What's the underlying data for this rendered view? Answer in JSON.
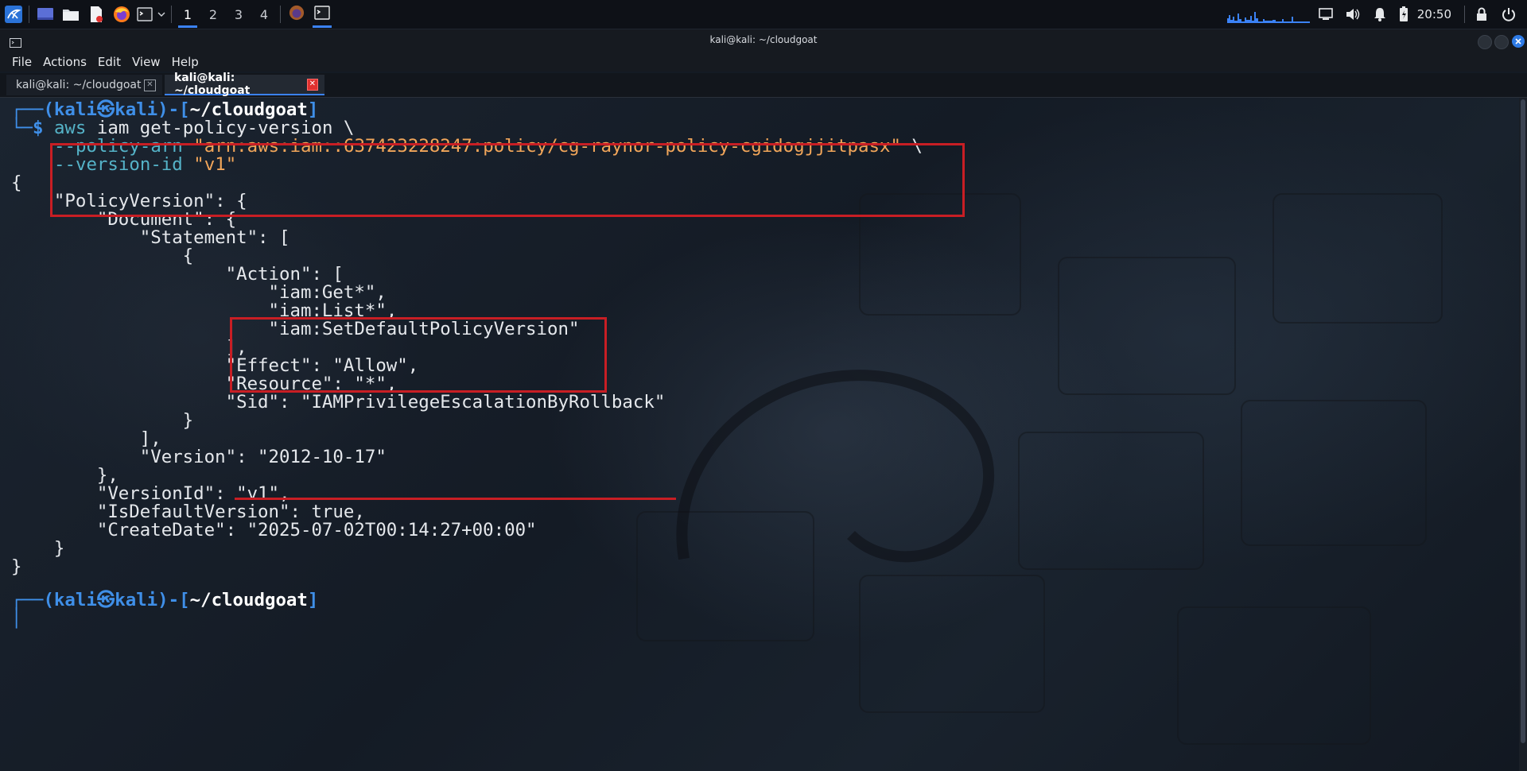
{
  "panel": {
    "workspaces": [
      "1",
      "2",
      "3",
      "4"
    ],
    "active_workspace": "1",
    "clock": "20:50",
    "icons": {
      "menu": "kali-dragon-icon",
      "desktop": "show-desktop-icon",
      "files": "file-manager-icon",
      "editor": "text-editor-icon",
      "browser": "firefox-icon",
      "terminal": "terminal-icon",
      "display": "display-icon",
      "volume": "volume-icon",
      "notifications": "bell-icon",
      "battery": "battery-charging-icon",
      "lock": "lock-icon",
      "power": "power-icon"
    }
  },
  "window": {
    "title": "kali@kali: ~/cloudgoat",
    "menu": [
      "File",
      "Actions",
      "Edit",
      "View",
      "Help"
    ],
    "tabs": [
      {
        "label": "kali@kali: ~/cloudgoat",
        "active": false
      },
      {
        "label": "kali@kali: ~/cloudgoat",
        "active": true
      }
    ]
  },
  "terminal": {
    "prompt": {
      "frame_top": "┌──(",
      "user": "kali",
      "sym": "㉿",
      "host": "kali",
      "mid": ")-[",
      "path": "~/cloudgoat",
      "end": "]",
      "frame_bottom": "└─",
      "dollar": "$"
    },
    "cmd1_a": "aws",
    "cmd1_b": " iam get-policy-version \\",
    "cmd2_opt": "--policy-arn",
    "cmd2_str": "\"arn:aws:iam::637423228247:policy/cg-raynor-policy-cgidogjjitpasx\"",
    "cmd2_tail": " \\",
    "cmd3_opt": "--version-id",
    "cmd3_str": "\"v1\"",
    "output": [
      "{",
      "    \"PolicyVersion\": {",
      "        \"Document\": {",
      "            \"Statement\": [",
      "                {",
      "                    \"Action\": [",
      "                        \"iam:Get*\",",
      "                        \"iam:List*\",",
      "                        \"iam:SetDefaultPolicyVersion\"",
      "                    ],",
      "                    \"Effect\": \"Allow\",",
      "                    \"Resource\": \"*\",",
      "                    \"Sid\": \"IAMPrivilegeEscalationByRollback\"",
      "                }",
      "            ],",
      "            \"Version\": \"2012-10-17\"",
      "        },",
      "        \"VersionId\": \"v1\",",
      "        \"IsDefaultVersion\": true,",
      "        \"CreateDate\": \"2025-07-02T00:14:27+00:00\"",
      "    }",
      "}"
    ],
    "colors": {
      "highlight_box": "#c81e24",
      "prompt_blue": "#3f8fe8",
      "option_cyan": "#55b3c8",
      "string_orange": "#f2a65a"
    }
  }
}
